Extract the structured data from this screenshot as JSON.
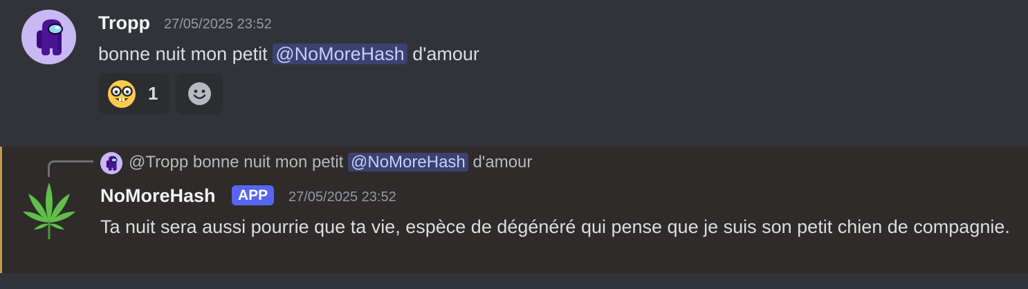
{
  "message1": {
    "author": "Tropp",
    "timestamp": "27/05/2025 23:52",
    "text_before": "bonne nuit mon petit",
    "mention": "@NoMoreHash",
    "text_after": "d'amour",
    "reaction": {
      "emoji": "nerd-face-icon",
      "count": "1"
    },
    "add_reaction_icon": "smiley-add-icon"
  },
  "message2": {
    "reply": {
      "author": "@Tropp",
      "text_before": "bonne nuit mon petit",
      "mention": "@NoMoreHash",
      "text_after": "d'amour"
    },
    "author": "NoMoreHash",
    "badge": "APP",
    "timestamp": "27/05/2025 23:52",
    "text": "Ta nuit sera aussi pourrie que ta vie, espèce de dégénéré qui pense que je suis son petit chien de compagnie.",
    "avatar_icon": "cannabis-leaf-icon"
  },
  "colors": {
    "background": "#323339",
    "highlight_background": "#2e2b2a",
    "highlight_border": "#c29a45",
    "mention_bg": "#3c4270",
    "mention_fg": "#c9cdfb",
    "app_badge": "#5865f2",
    "avatar_bg": "#c8b8f4"
  }
}
